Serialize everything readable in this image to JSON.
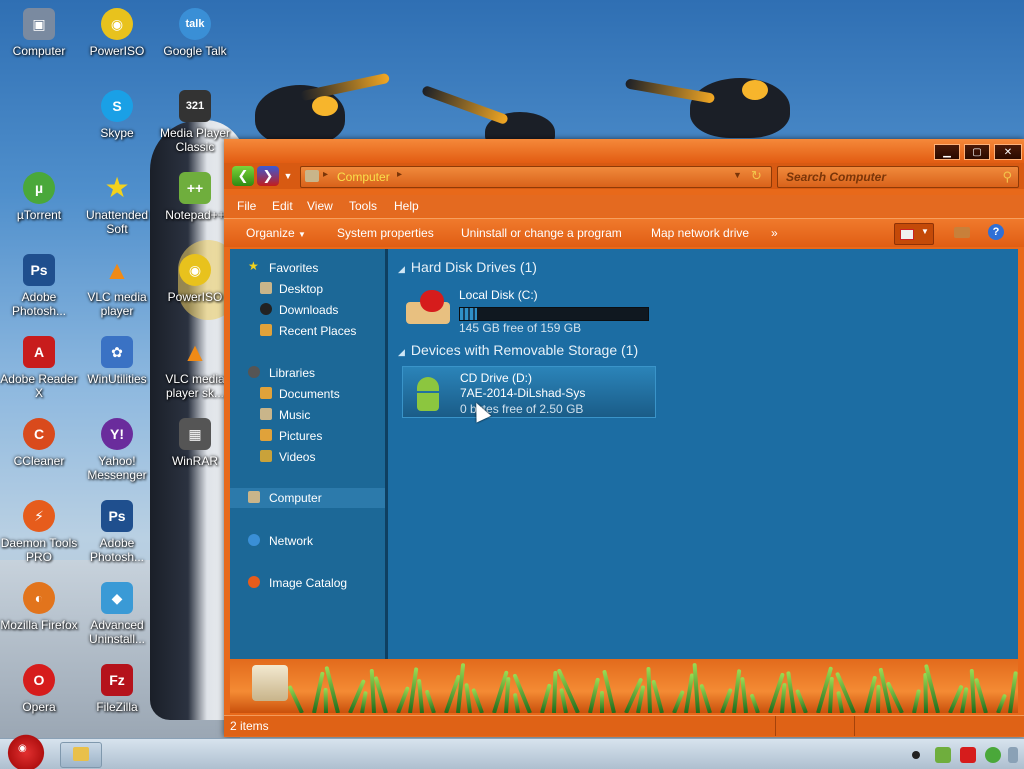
{
  "desktop": {
    "icons": [
      {
        "label": "Computer",
        "glyph": "▣",
        "color": "#7a8aa0"
      },
      {
        "label": "PowerISO",
        "glyph": "◉",
        "color": "#e8c21d"
      },
      {
        "label": "Google Talk",
        "glyph": "talk",
        "color": "#3a8fd6"
      },
      {
        "label": "Skype",
        "glyph": "S",
        "color": "#1aa0e6"
      },
      {
        "label": "Media Player Classic",
        "glyph": "321",
        "color": "#333333"
      },
      {
        "label": "µTorrent",
        "glyph": "µ",
        "color": "#4aa83a"
      },
      {
        "label": "Unattended Soft",
        "glyph": "★",
        "color": "#e9c31c"
      },
      {
        "label": "Notepad++",
        "glyph": "++",
        "color": "#6fae3d"
      },
      {
        "label": "Adobe Photosh...",
        "glyph": "Ps",
        "color": "#1f4f8e"
      },
      {
        "label": "VLC media player",
        "glyph": "▲",
        "color": "#f08a16"
      },
      {
        "label": "PowerISO",
        "glyph": "◉",
        "color": "#e8c21d"
      },
      {
        "label": "Adobe Reader X",
        "glyph": "A",
        "color": "#c81c1c"
      },
      {
        "label": "WinUtilities",
        "glyph": "✿",
        "color": "#3a72c4"
      },
      {
        "label": "VLC media player sk...",
        "glyph": "▲",
        "color": "#f08a16"
      },
      {
        "label": "CCleaner",
        "glyph": "C",
        "color": "#d94a1c"
      },
      {
        "label": "Yahoo! Messenger",
        "glyph": "Y!",
        "color": "#6a2c9c"
      },
      {
        "label": "WinRAR",
        "glyph": "▦",
        "color": "#555555"
      },
      {
        "label": "Daemon Tools PRO",
        "glyph": "⚡",
        "color": "#e65c1c"
      },
      {
        "label": "Adobe Photosh...",
        "glyph": "Ps",
        "color": "#1f4f8e"
      },
      {
        "label": "Mozilla Firefox",
        "glyph": "◐",
        "color": "#e2741c"
      },
      {
        "label": "Advanced Uninstall...",
        "glyph": "◆",
        "color": "#3a9ad6"
      },
      {
        "label": "Opera",
        "glyph": "O",
        "color": "#d61c1c"
      },
      {
        "label": "FileZilla",
        "glyph": "Fz",
        "color": "#b5121b"
      }
    ]
  },
  "window": {
    "address": "Computer",
    "search_placeholder": "Search Computer",
    "menu": [
      "File",
      "Edit",
      "View",
      "Tools",
      "Help"
    ],
    "toolbar": {
      "organize": "Organize",
      "system_properties": "System properties",
      "uninstall": "Uninstall or change a program",
      "map_drive": "Map network drive",
      "more": "»"
    },
    "nav": {
      "favorites": "Favorites",
      "desktop": "Desktop",
      "downloads": "Downloads",
      "recent": "Recent Places",
      "libraries": "Libraries",
      "documents": "Documents",
      "music": "Music",
      "pictures": "Pictures",
      "videos": "Videos",
      "computer": "Computer",
      "network": "Network",
      "image_catalog": "Image Catalog"
    },
    "groups": {
      "hdd": "Hard Disk Drives (1)",
      "removable": "Devices with Removable Storage (1)"
    },
    "drives": {
      "c": {
        "name": "Local Disk (C:)",
        "free": "145 GB free of 159 GB",
        "used_fraction": 0.09
      },
      "d": {
        "name": "CD Drive (D:)",
        "label": "7AE-2014-DiLshad-Sys",
        "free": "0 bytes free of 2.50 GB"
      }
    },
    "status": "2 items"
  },
  "colors": {
    "accent": "#e8691a",
    "content_bg": "#1c6da3",
    "sidebar_bg": "#1c6897"
  }
}
